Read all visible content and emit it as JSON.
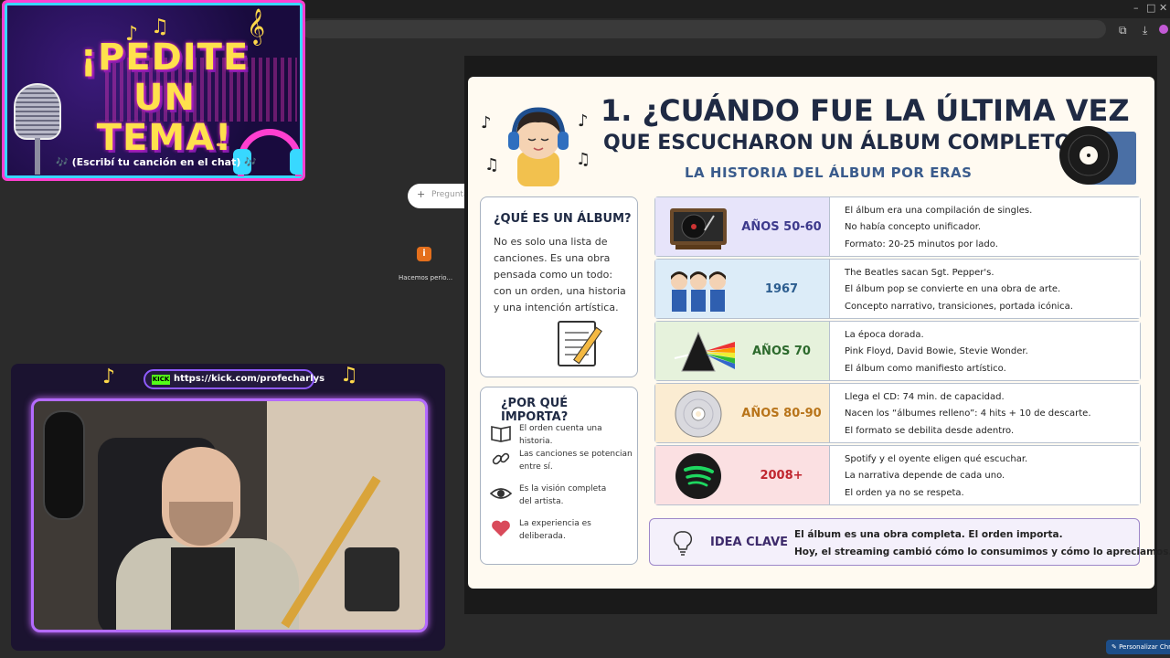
{
  "browser": {
    "controls": {
      "minimize": "–",
      "maximize": "□",
      "close": "✕"
    },
    "toolbar_icons": [
      "puzzle-icon",
      "download-icon",
      "profile-icon"
    ]
  },
  "overlay_pedite": {
    "title_line1": "¡PEDITE",
    "title_line2": "UN TEMA!",
    "subtitle": "🎶 (Escribí tu canción en el chat) 🎶"
  },
  "floating_pill": {
    "icon": "+",
    "text": "Preguntá"
  },
  "desktop_icon": {
    "glyph": "i",
    "label": "Hacemos perio..."
  },
  "webcam": {
    "kick_badge": "KICK",
    "kick_url": "https://kick.com/profecharlys"
  },
  "slide": {
    "title_line1": "1. ¿CUÁNDO FUE LA ÚLTIMA VEZ",
    "title_line2": "QUE ESCUCHARON UN ÁLBUM COMPLETO?",
    "subtitle": "LA HISTORIA DEL ÁLBUM POR ERAS",
    "what": {
      "heading": "¿QUÉ ES UN ÁLBUM?",
      "lines": [
        "No es solo una lista de",
        "canciones. Es una obra",
        "pensada como un todo:",
        "con un orden, una historia",
        "y una intención artística."
      ]
    },
    "why": {
      "heading": "¿POR QUÉ IMPORTA?",
      "items": [
        {
          "icon": "book-icon",
          "line1": "El orden cuenta una historia.",
          "line2": ""
        },
        {
          "icon": "link-icon",
          "line1": "Las canciones se potencian",
          "line2": "entre sí."
        },
        {
          "icon": "eye-icon",
          "line1": "Es la visión completa",
          "line2": "del artista."
        },
        {
          "icon": "heart-icon",
          "line1": "La experiencia es",
          "line2": "deliberada."
        }
      ]
    },
    "eras": [
      {
        "label": "AÑOS 50-60",
        "color": "#3d3a8c",
        "bg": "#e7e4fa",
        "pic": "turntable-icon",
        "lines": [
          "El álbum era una compilación de singles.",
          "No había concepto unificador.",
          "Formato: 20-25 minutos por lado."
        ]
      },
      {
        "label": "1967",
        "color": "#2c5d8f",
        "bg": "#dcecf8",
        "pic": "beatles-icon",
        "lines": [
          "The Beatles sacan Sgt. Pepper's.",
          "El álbum pop se convierte en una obra de arte.",
          "Concepto narrativo, transiciones, portada icónica."
        ]
      },
      {
        "label": "AÑOS 70",
        "color": "#2d6a2d",
        "bg": "#e6f2dc",
        "pic": "prism-icon",
        "lines": [
          "La época dorada.",
          "Pink Floyd, David Bowie, Stevie Wonder.",
          "El álbum como manifiesto artístico."
        ]
      },
      {
        "label": "AÑOS 80-90",
        "color": "#b8741a",
        "bg": "#fbecd2",
        "pic": "cd-icon",
        "lines": [
          "Llega el CD: 74 min. de capacidad.",
          "Nacen los “álbumes relleno”: 4 hits + 10 de descarte.",
          "El formato se debilita desde adentro."
        ]
      },
      {
        "label": "2008+",
        "color": "#c0262f",
        "bg": "#fbe0e2",
        "pic": "spotify-icon",
        "lines": [
          "Spotify y el oyente eligen qué escuchar.",
          "La narrativa depende de cada uno.",
          "El orden ya no se respeta."
        ]
      }
    ],
    "idea": {
      "title": "IDEA CLAVE",
      "line1": "El álbum es una obra completa. El orden importa.",
      "line2": "Hoy, el streaming cambió cómo lo consumimos y cómo lo apreciamos."
    }
  },
  "bottom_tab": {
    "label": "✎ Personalizar Chrome"
  }
}
